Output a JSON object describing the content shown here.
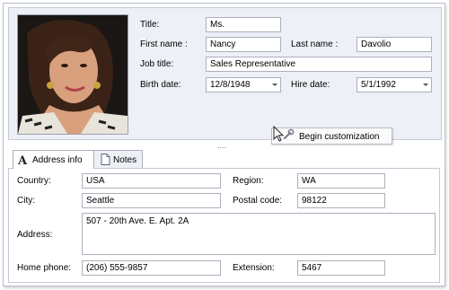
{
  "top": {
    "title": {
      "label": "Title:",
      "value": "Ms."
    },
    "first_name": {
      "label": "First name :",
      "value": "Nancy"
    },
    "last_name": {
      "label": "Last name :",
      "value": "Davolio"
    },
    "job_title": {
      "label": "Job title:",
      "value": "Sales Representative"
    },
    "birth_date": {
      "label": "Birth date:",
      "value": "12/8/1948"
    },
    "hire_date": {
      "label": "Hire date:",
      "value": "5/1/1992"
    }
  },
  "customization": {
    "label": "Begin customization"
  },
  "splitter": {
    "dots": "...."
  },
  "tabs": [
    {
      "label": "Address info",
      "icon": "text-A-icon",
      "active": true
    },
    {
      "label": "Notes",
      "icon": "document-icon",
      "active": false
    }
  ],
  "address": {
    "country": {
      "label": "Country:",
      "value": "USA"
    },
    "region": {
      "label": "Region:",
      "value": "WA"
    },
    "city": {
      "label": "City:",
      "value": "Seattle"
    },
    "postal_code": {
      "label": "Postal code:",
      "value": "98122"
    },
    "address": {
      "label": "Address:",
      "value": "507 - 20th Ave. E. Apt. 2A"
    },
    "home_phone": {
      "label": "Home phone:",
      "value": "(206) 555-9857"
    },
    "extension": {
      "label": "Extension:",
      "value": "5467"
    }
  },
  "colors": {
    "panel_bg": "#eef0f7",
    "border": "#abb1bd"
  }
}
